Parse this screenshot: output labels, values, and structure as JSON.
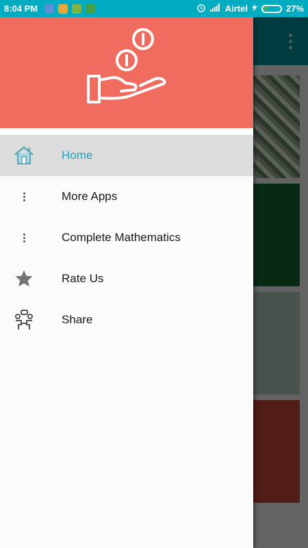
{
  "status_bar": {
    "time": "8:04 PM",
    "carrier": "Airtel",
    "battery": "27%",
    "battery_level": 0.27,
    "icons": [
      "app-icon-1",
      "app-icon-2",
      "app-icon-3",
      "app-icon-4",
      "alarm-icon",
      "signal-icon",
      "charging-icon",
      "battery-icon"
    ]
  },
  "drawer": {
    "header_logo": "hand-coins-icon",
    "items": [
      {
        "label": "Home",
        "icon": "home-icon",
        "active": true
      },
      {
        "label": "More Apps",
        "icon": "more-vert-icon",
        "active": false
      },
      {
        "label": "Complete Mathematics",
        "icon": "more-vert-icon",
        "active": false
      },
      {
        "label": "Rate Us",
        "icon": "star-icon",
        "active": false
      },
      {
        "label": "Share",
        "icon": "share-people-icon",
        "active": false
      }
    ]
  },
  "colors": {
    "status_bar": "#00acc1",
    "header": "#ef6c5f",
    "active_text": "#1fa5c4",
    "toolbar": "#00838f"
  }
}
